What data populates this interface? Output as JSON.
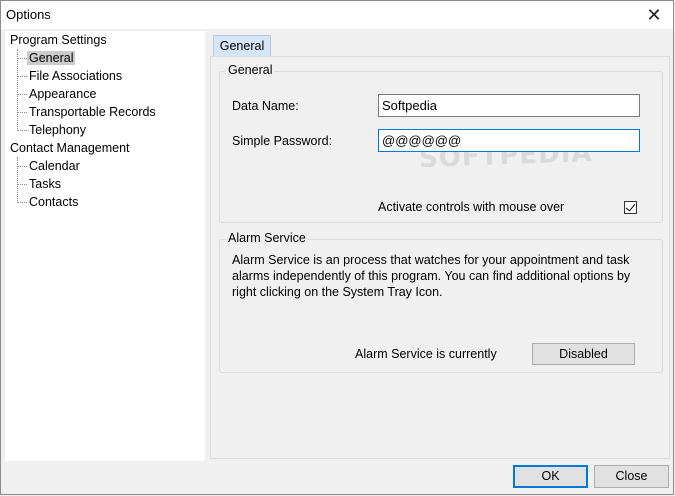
{
  "window": {
    "title": "Options"
  },
  "tree": {
    "groups": [
      {
        "label": "Program Settings",
        "items": [
          "General",
          "File Associations",
          "Appearance",
          "Transportable Records",
          "Telephony"
        ]
      },
      {
        "label": "Contact Management",
        "items": [
          "Calendar",
          "Tasks",
          "Contacts"
        ]
      }
    ],
    "selected": "General"
  },
  "tabs": {
    "general": "General"
  },
  "general_group": {
    "title": "General",
    "data_name_label": "Data Name:",
    "data_name_value": "Softpedia",
    "password_label": "Simple Password:",
    "password_value": "@@@@@@",
    "activate_label": "Activate controls with mouse over",
    "activate_checked": true
  },
  "alarm_group": {
    "title": "Alarm Service",
    "description": "Alarm Service is an process that watches for your appointment and task alarms independently of this program.  You can find additional options by right clicking on the System Tray Icon.",
    "status_label": "Alarm Service is currently",
    "status_button": "Disabled"
  },
  "footer": {
    "ok": "OK",
    "close": "Close"
  },
  "watermark": "SOFTPEDIA"
}
